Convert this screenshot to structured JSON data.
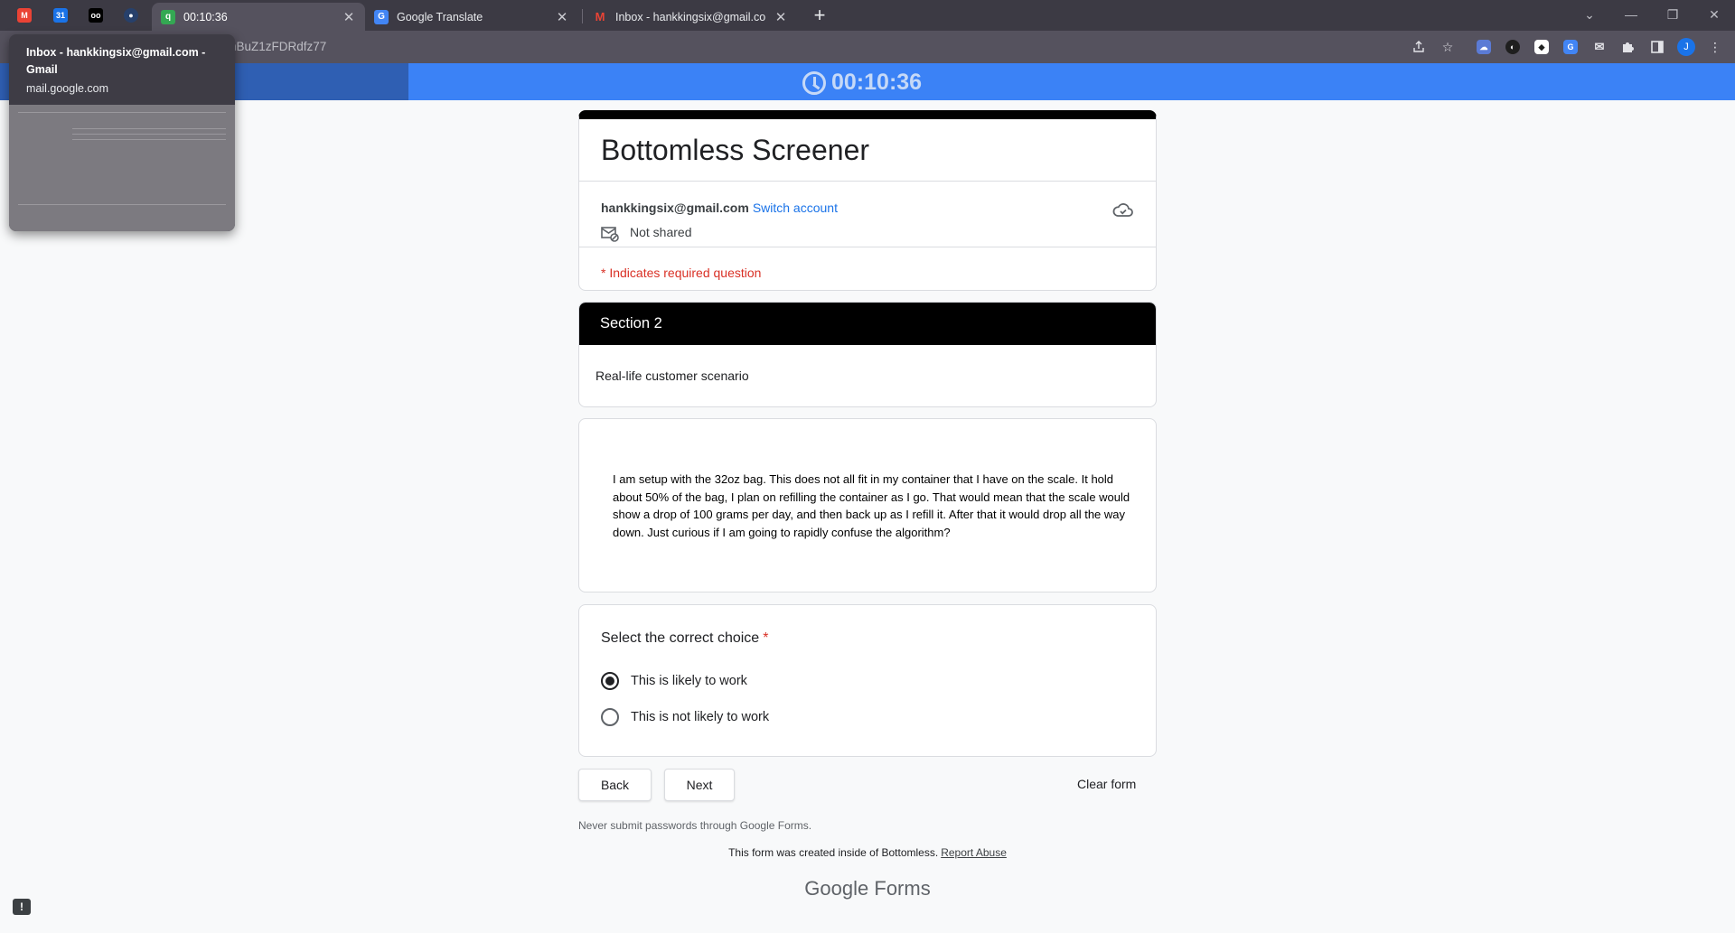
{
  "browser": {
    "pinned_tabs": [
      {
        "icon": "gmail-icon",
        "color": "#ea4335",
        "glyph": "M"
      },
      {
        "icon": "calendar-icon",
        "color": "#1a73e8",
        "glyph": "31"
      },
      {
        "icon": "app-icon",
        "color": "#000000",
        "glyph": "o"
      },
      {
        "icon": "globe-app-icon",
        "color": "#27406b",
        "glyph": "●"
      }
    ],
    "tabs": [
      {
        "title": "00:10:36",
        "icon": "q-app-icon",
        "active": true
      },
      {
        "title": "Google Translate",
        "icon": "translate-icon",
        "active": false
      },
      {
        "title": "Inbox - hankkingsix@gmail.com",
        "icon": "gmail-icon",
        "active": false
      }
    ],
    "address_fragment": "hBuZ1zFDRdfz77",
    "profile_initial": "J"
  },
  "hover_card": {
    "title": "Inbox - hankkingsix@gmail.com - Gmail",
    "domain": "mail.google.com"
  },
  "timer": {
    "value": "00:10:36"
  },
  "form": {
    "title": "Bottomless Screener",
    "account_email": "hankkingsix@gmail.com",
    "switch_account": "Switch account",
    "not_shared": "Not shared",
    "required_note": "* Indicates required question",
    "section_title": "Section 2",
    "section_description": "Real-life customer scenario",
    "scenario_text": "I am setup with the 32oz bag.  This does not all fit in my container that I have on the scale.  It hold about 50% of the bag, I plan on refilling the container as I go.  That would mean that the scale would show a drop of 100 grams per day, and then back up as I refill it.  After that it would drop all the way down.  Just curious if I am going to rapidly confuse the algorithm?",
    "question": {
      "label": "Select the correct choice",
      "required_mark": "*",
      "options": [
        {
          "label": "This is likely to work",
          "selected": true
        },
        {
          "label": "This is not likely to work",
          "selected": false
        }
      ]
    },
    "buttons": {
      "back": "Back",
      "next": "Next",
      "clear": "Clear form"
    },
    "footer": {
      "never_submit": "Never submit passwords through Google Forms.",
      "created": "This form was created inside of Bottomless.",
      "report_abuse": "Report Abuse",
      "brand_google": "Google",
      "brand_forms": "Forms"
    }
  },
  "colors": {
    "timer_bar": "#3b82f6",
    "form_accent": "#000000",
    "link": "#1a73e8",
    "required": "#d93025"
  }
}
